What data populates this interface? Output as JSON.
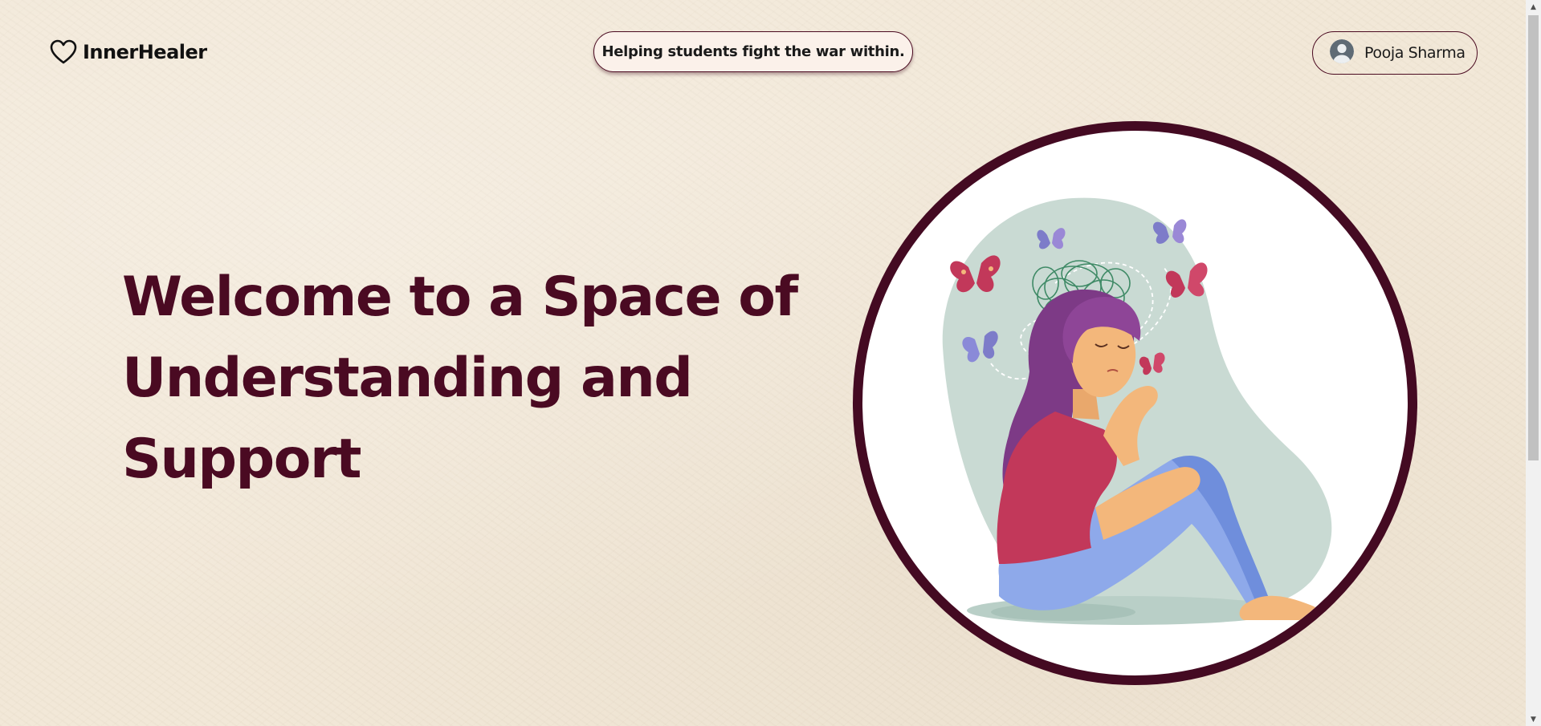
{
  "header": {
    "brand_name": "InnerHealer",
    "brand_icon": "heart-outline-icon",
    "tagline": "Helping students fight the war within.",
    "user": {
      "name": "Pooja Sharma",
      "avatar_icon": "user-avatar-icon"
    }
  },
  "hero": {
    "title": "Welcome to a Space of Understanding and Support",
    "illustration": "sad-girl-with-butterflies-illustration"
  },
  "colors": {
    "background": "#f2e8d8",
    "accent": "#4a0a22",
    "circle_border": "#440a22"
  }
}
